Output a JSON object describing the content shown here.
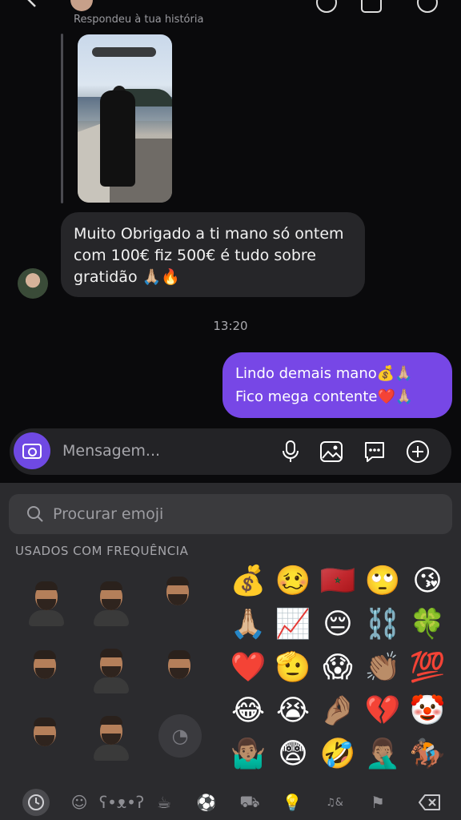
{
  "conversation": {
    "reply_label": "Respondeu à tua história",
    "incoming_message": "Muito Obrigado a ti mano só ontem com 100€ fiz 500€ é tudo sobre gratidão 🙏🏼🔥",
    "timestamp": "13:20",
    "outgoing_message_line1": "Lindo demais mano💰🙏🏼",
    "outgoing_message_line2": "Fico mega contente❤️🙏🏼"
  },
  "composer": {
    "placeholder": "Mensagem..."
  },
  "emoji_keyboard": {
    "search_placeholder": "Procurar emoji",
    "section_title": "USADOS COM FREQUÊNCIA",
    "emojis": [
      [
        "💰",
        "🥴",
        "🇲🇦",
        "🙄",
        "😘"
      ],
      [
        "🙏🏼",
        "📈",
        "😔",
        "⛓️",
        "🍀"
      ],
      [
        "❤️",
        "🫡",
        "😱",
        "👏🏽",
        "💯"
      ],
      [
        "😂",
        "😭",
        "🤌🏽",
        "💔",
        "🤡"
      ],
      [
        "🤷🏽‍♂️",
        "😨",
        "🤣",
        "🤦🏽‍♂️",
        "🏇🏽"
      ]
    ],
    "categories": [
      "frequently-used",
      "smileys",
      "animals",
      "food",
      "activity",
      "travel",
      "objects",
      "symbols",
      "flags",
      "delete"
    ]
  }
}
